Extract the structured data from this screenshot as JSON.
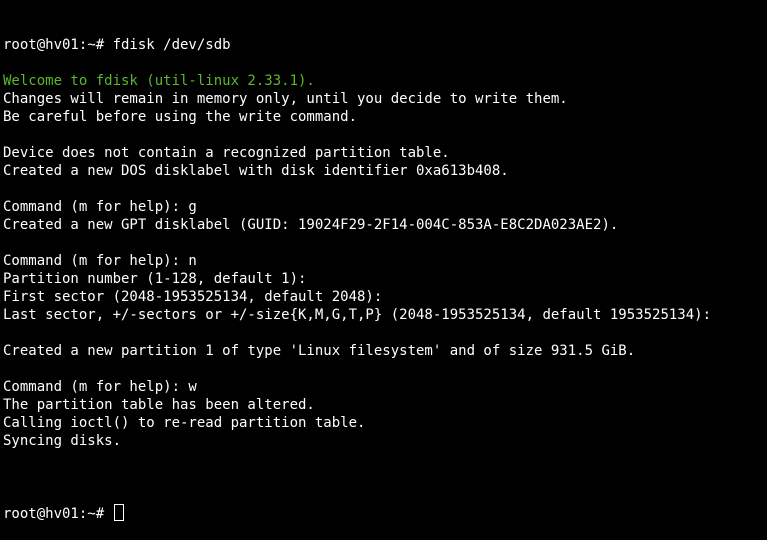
{
  "terminal": {
    "lines": [
      {
        "text": "root@hv01:~# fdisk /dev/sdb",
        "style": "normal"
      },
      {
        "text": "",
        "style": "normal"
      },
      {
        "text": "Welcome to fdisk (util-linux 2.33.1).",
        "style": "green"
      },
      {
        "text": "Changes will remain in memory only, until you decide to write them.",
        "style": "normal"
      },
      {
        "text": "Be careful before using the write command.",
        "style": "normal"
      },
      {
        "text": "",
        "style": "normal"
      },
      {
        "text": "Device does not contain a recognized partition table.",
        "style": "normal"
      },
      {
        "text": "Created a new DOS disklabel with disk identifier 0xa613b408.",
        "style": "normal"
      },
      {
        "text": "",
        "style": "normal"
      },
      {
        "text": "Command (m for help): g",
        "style": "normal"
      },
      {
        "text": "Created a new GPT disklabel (GUID: 19024F29-2F14-004C-853A-E8C2DA023AE2).",
        "style": "normal"
      },
      {
        "text": "",
        "style": "normal"
      },
      {
        "text": "Command (m for help): n",
        "style": "normal"
      },
      {
        "text": "Partition number (1-128, default 1):",
        "style": "normal"
      },
      {
        "text": "First sector (2048-1953525134, default 2048):",
        "style": "normal"
      },
      {
        "text": "Last sector, +/-sectors or +/-size{K,M,G,T,P} (2048-1953525134, default 1953525134):",
        "style": "normal"
      },
      {
        "text": "",
        "style": "normal"
      },
      {
        "text": "Created a new partition 1 of type 'Linux filesystem' and of size 931.5 GiB.",
        "style": "normal"
      },
      {
        "text": "",
        "style": "normal"
      },
      {
        "text": "Command (m for help): w",
        "style": "normal"
      },
      {
        "text": "The partition table has been altered.",
        "style": "normal"
      },
      {
        "text": "Calling ioctl() to re-read partition table.",
        "style": "normal"
      },
      {
        "text": "Syncing disks.",
        "style": "normal"
      },
      {
        "text": "",
        "style": "normal"
      }
    ],
    "prompt": "root@hv01:~# ",
    "colors": {
      "background": "#000000",
      "foreground": "#ffffff",
      "accent_green": "#59b82c"
    }
  }
}
